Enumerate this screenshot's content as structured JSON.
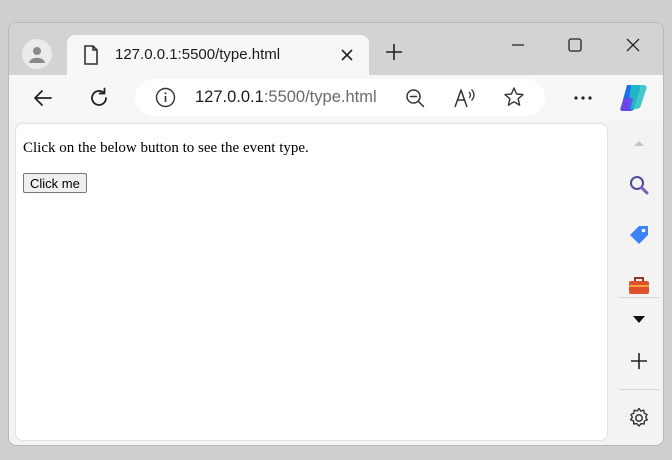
{
  "browser": {
    "tab": {
      "title": "127.0.0.1:5500/type.html"
    },
    "address": {
      "host": "127.0.0.1",
      "rest": ":5500/type.html"
    },
    "icons": {
      "profile": "profile-icon",
      "tab": "page-icon",
      "back": "back-arrow-icon",
      "reload": "reload-icon",
      "info": "info-icon",
      "zoom": "zoom-out-icon",
      "read_aloud": "read-aloud-icon",
      "favorite": "star-icon",
      "more": "more-icon",
      "copilot": "copilot-icon"
    },
    "sidebar": [
      "scroll-up-icon",
      "search-icon",
      "shopping-tag-icon",
      "toolbox-icon",
      "dropdown-icon",
      "add-icon",
      "settings-icon"
    ]
  },
  "page": {
    "text": "Click on the below button to see the event type.",
    "button_label": "Click me"
  },
  "colors": {
    "accent_copilot": "#1a73e8",
    "tag": "#3b82f6",
    "toolbox": "#e1502d"
  }
}
